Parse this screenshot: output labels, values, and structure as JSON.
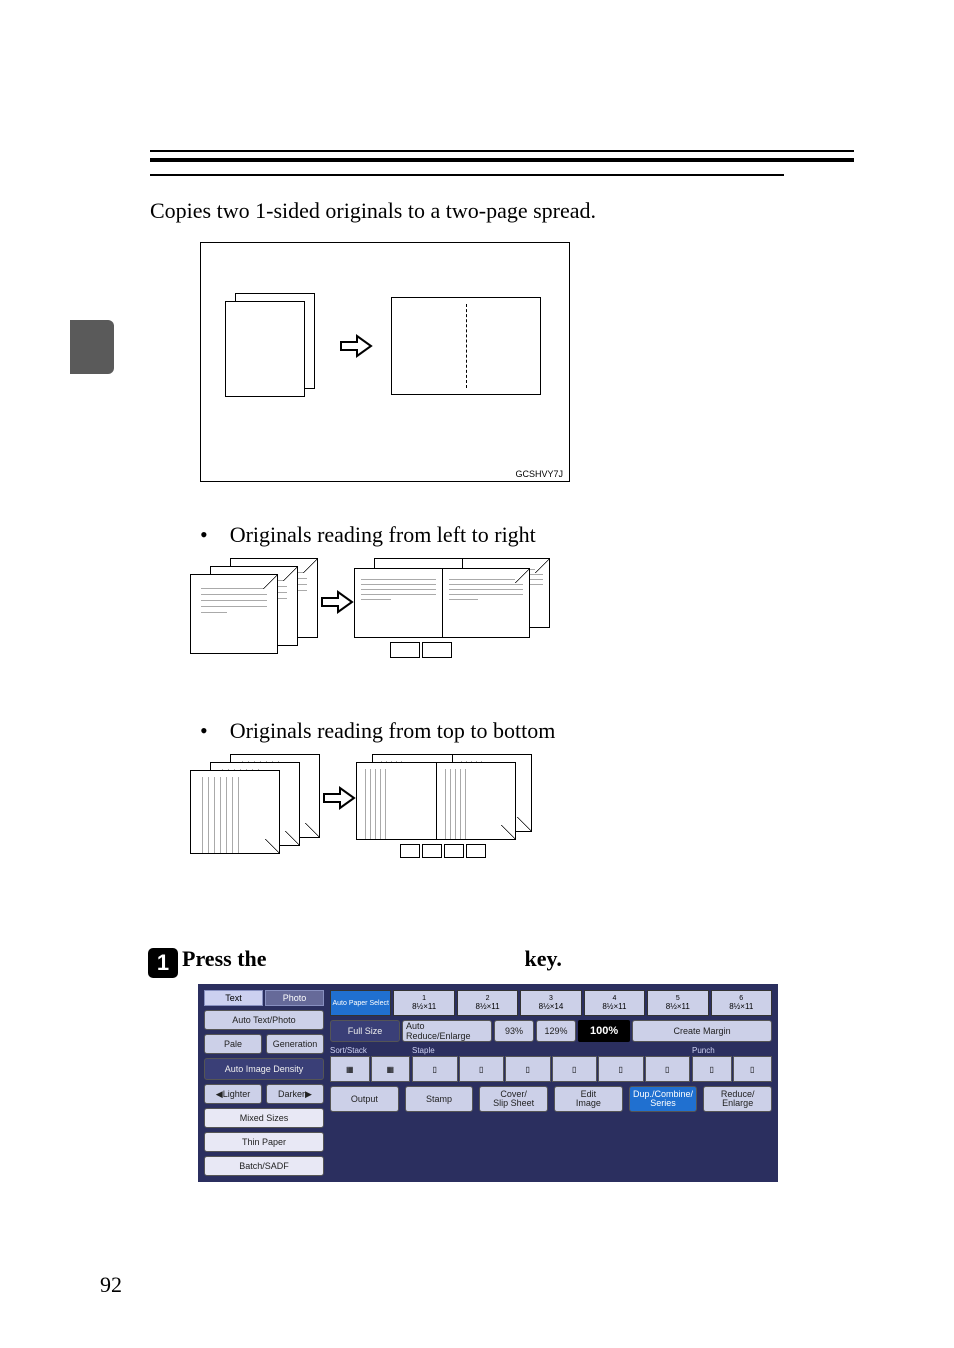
{
  "intro_text": "Copies two 1-sided originals to a two-page spread.",
  "diagram_code": "GCSHVY7J",
  "bullet_left_right": "• Originals reading from left to right",
  "bullet_top_bottom": "• Originals reading from top to bottom",
  "step_1": {
    "badge": "1",
    "prefix": "Press the",
    "suffix": "key."
  },
  "ui": {
    "left_tabs": [
      "Text",
      "Photo"
    ],
    "left_btn1": "Auto Text/Photo",
    "left_row": [
      "Pale",
      "Generation"
    ],
    "auto_density": "Auto Image Density",
    "lighter": "Lighter",
    "darker": "Darker",
    "mixed": "Mixed Sizes",
    "thin": "Thin Paper",
    "batch": "Batch/SADF",
    "paper_select": "Auto Paper Select",
    "trays": [
      {
        "n": "1",
        "size": "8½×11"
      },
      {
        "n": "2",
        "size": "8½×11"
      },
      {
        "n": "3",
        "size": "8½×14"
      },
      {
        "n": "4",
        "size": "8½×11"
      },
      {
        "n": "5",
        "size": "8½×11"
      },
      {
        "n": "6",
        "size": "8½×11"
      }
    ],
    "full_size": "Full Size",
    "auto_re": "Auto Reduce/Enlarge",
    "pct_a": "93%",
    "pct_b": "129%",
    "pct_big": "100%",
    "create_margin": "Create Margin",
    "sort_label": "Sort/Stack",
    "staple_label": "Staple",
    "punch_label": "Punch",
    "bottom": [
      "Output",
      "Stamp",
      "Cover/\nSlip Sheet",
      "Edit\nImage",
      "Dup./Combine/\nSeries",
      "Reduce/\nEnlarge"
    ]
  },
  "page_number": "92"
}
